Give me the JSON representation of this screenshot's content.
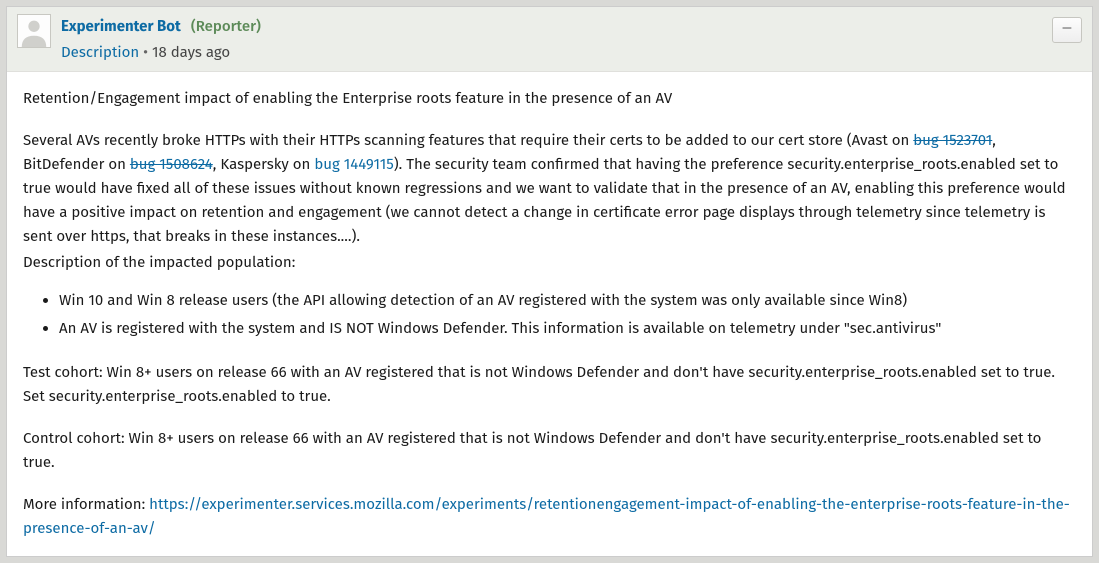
{
  "header": {
    "author": "Experimenter Bot",
    "role": "(Reporter)",
    "descriptionLabel": "Description",
    "separator": " • ",
    "timestamp": "18 days ago",
    "collapseGlyph": "–"
  },
  "body": {
    "title": "Retention/Engagement impact of enabling the Enterprise roots feature in the presence of an AV",
    "p1_a": "Several AVs recently broke HTTPs with their HTTPs scanning features that require their certs to be added to our cert store (Avast on ",
    "bug1": "bug 1523701",
    "p1_b": ", BitDefender on ",
    "bug2": "bug 1508624",
    "p1_c": ", Kaspersky on ",
    "bug3": "bug 1449115",
    "p1_d": "). The security team confirmed that having the preference security.enterprise_roots.enabled set to true would have fixed all of these issues without known regressions and we want to validate that in the presence of an AV, enabling this preference would have a positive impact on retention and engagement (we cannot detect a change in certificate error page displays through telemetry since telemetry is sent over https, that breaks in these instances....).",
    "pop_desc": "Description of the impacted population:",
    "li1": "Win 10 and Win 8 release users (the API allowing detection of an AV registered with the system was only available since Win8)",
    "li2": "An AV is registered with the system and IS NOT Windows Defender. This information is available on telemetry under \"sec.antivirus\"",
    "testCohort": "Test cohort: Win 8+ users on release 66 with an AV registered that is not Windows Defender and don't have security.enterprise_roots.enabled set to true. Set security.enterprise_roots.enabled to true.",
    "controlCohort": "Control cohort: Win 8+ users on release 66 with an AV registered that is not Windows Defender and don't have security.enterprise_roots.enabled set to true.",
    "moreInfoLabel": "More information: ",
    "moreInfoUrl": "https://experimenter.services.mozilla.com/experiments/retentionengagement-impact-of-enabling-the-enterprise-roots-feature-in-the-presence-of-an-av/"
  }
}
